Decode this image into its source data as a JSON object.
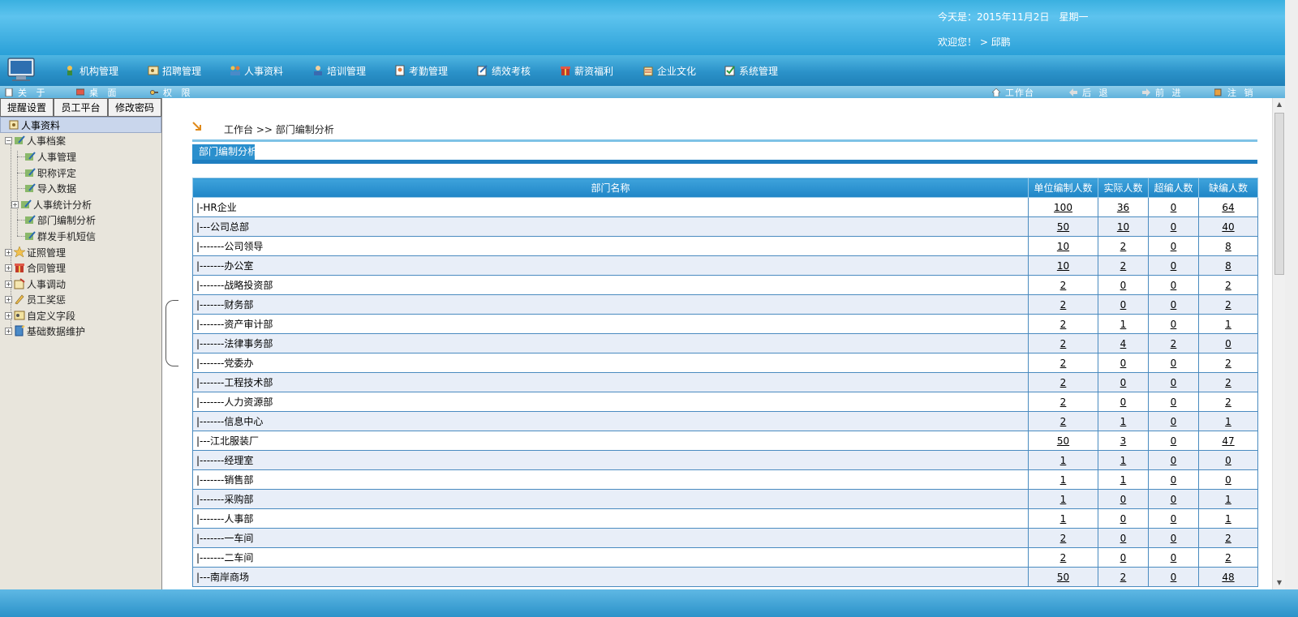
{
  "header": {
    "date_text": "今天是：2015年11月2日　星期一",
    "welcome_text": "欢迎您！ > 邱鹏"
  },
  "main_nav": [
    {
      "label": "机构管理",
      "icon": "org-icon"
    },
    {
      "label": "招聘管理",
      "icon": "recruit-icon"
    },
    {
      "label": "人事资料",
      "icon": "personnel-icon"
    },
    {
      "label": "培训管理",
      "icon": "training-icon"
    },
    {
      "label": "考勤管理",
      "icon": "attendance-icon"
    },
    {
      "label": "绩效考核",
      "icon": "performance-icon"
    },
    {
      "label": "薪资福利",
      "icon": "salary-icon"
    },
    {
      "label": "企业文化",
      "icon": "culture-icon"
    },
    {
      "label": "系统管理",
      "icon": "system-icon"
    }
  ],
  "sub_nav_left": [
    {
      "label": "关 于"
    },
    {
      "label": "桌 面"
    },
    {
      "label": "权 限"
    }
  ],
  "sub_nav_right": [
    {
      "label": "工作台"
    },
    {
      "label": "后 退"
    },
    {
      "label": "前 进"
    },
    {
      "label": "注 销"
    }
  ],
  "left_panel": {
    "buttons": [
      "提醒设置",
      "员工平台",
      "修改密码"
    ],
    "module_title": "人事资料",
    "tree": {
      "archive": "人事档案",
      "archive_children": [
        "人事管理",
        "职称评定",
        "导入数据",
        "人事统计分析",
        "部门编制分析",
        "群发手机短信"
      ],
      "roots": [
        "证照管理",
        "合同管理",
        "人事调动",
        "员工奖惩",
        "自定义字段",
        "基础数据维护"
      ]
    }
  },
  "content": {
    "breadcrumb": "工作台 >> 部门编制分析",
    "tab_label": "部门编制分析",
    "table": {
      "headers": [
        "部门名称",
        "单位编制人数",
        "实际人数",
        "超编人数",
        "缺编人数"
      ],
      "rows": [
        [
          "|-HR企业",
          "100",
          "36",
          "0",
          "64"
        ],
        [
          "|---公司总部",
          "50",
          "10",
          "0",
          "40"
        ],
        [
          "|-------公司领导",
          "10",
          "2",
          "0",
          "8"
        ],
        [
          "|-------办公室",
          "10",
          "2",
          "0",
          "8"
        ],
        [
          "|-------战略投资部",
          "2",
          "0",
          "0",
          "2"
        ],
        [
          "|-------财务部",
          "2",
          "0",
          "0",
          "2"
        ],
        [
          "|-------资产审计部",
          "2",
          "1",
          "0",
          "1"
        ],
        [
          "|-------法律事务部",
          "2",
          "4",
          "2",
          "0"
        ],
        [
          "|-------党委办",
          "2",
          "0",
          "0",
          "2"
        ],
        [
          "|-------工程技术部",
          "2",
          "0",
          "0",
          "2"
        ],
        [
          "|-------人力资源部",
          "2",
          "0",
          "0",
          "2"
        ],
        [
          "|-------信息中心",
          "2",
          "1",
          "0",
          "1"
        ],
        [
          "|---江北服装厂",
          "50",
          "3",
          "0",
          "47"
        ],
        [
          "|-------经理室",
          "1",
          "1",
          "0",
          "0"
        ],
        [
          "|-------销售部",
          "1",
          "1",
          "0",
          "0"
        ],
        [
          "|-------采购部",
          "1",
          "0",
          "0",
          "1"
        ],
        [
          "|-------人事部",
          "1",
          "0",
          "0",
          "1"
        ],
        [
          "|-------一车间",
          "2",
          "0",
          "0",
          "2"
        ],
        [
          "|-------二车间",
          "2",
          "0",
          "0",
          "2"
        ],
        [
          "|---南岸商场",
          "50",
          "2",
          "0",
          "48"
        ]
      ]
    }
  },
  "colors": {
    "header_blue": "#3ab0e0",
    "table_header": "#2a8fcd",
    "alt_row": "#e8eef8"
  }
}
